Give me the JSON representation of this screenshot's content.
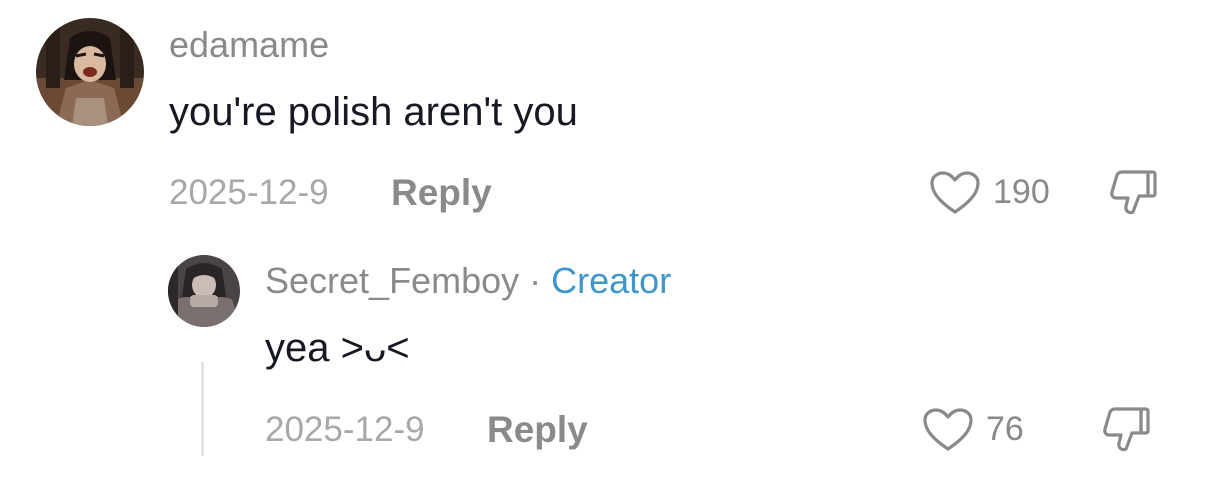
{
  "comment": {
    "username": "edamame",
    "text": "you're polish aren't you",
    "date": "2025-12-9",
    "reply_label": "Reply",
    "like_count": "190",
    "icons": {
      "like": "heart-outline-icon",
      "dislike": "thumbs-down-icon"
    }
  },
  "reply": {
    "username": "Secret_Femboy",
    "separator": "·",
    "badge": "Creator",
    "text": "yea >ᴗ<",
    "date": "2025-12-9",
    "reply_label": "Reply",
    "like_count": "76",
    "icons": {
      "like": "heart-outline-icon",
      "dislike": "thumbs-down-icon"
    }
  },
  "colors": {
    "badge": "#3f96c8",
    "muted_text": "#8a8a8a",
    "date_text": "#a8a8a8",
    "body_text": "#161823"
  }
}
